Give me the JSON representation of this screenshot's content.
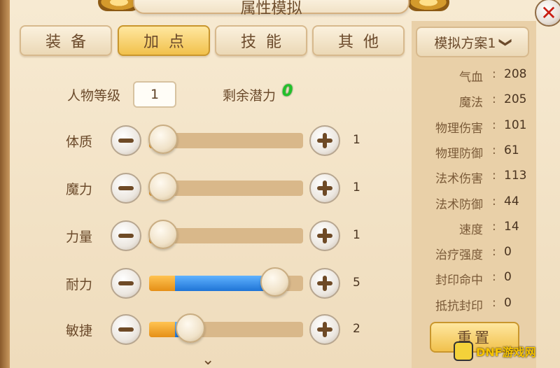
{
  "title": "属性模拟",
  "close_label": "✕",
  "tabs": [
    {
      "label": "装备",
      "active": false
    },
    {
      "label": "加点",
      "active": true
    },
    {
      "label": "技能",
      "active": false
    },
    {
      "label": "其他",
      "active": false
    }
  ],
  "level": {
    "label": "人物等级",
    "value": "1"
  },
  "potential": {
    "label": "剩余潜力",
    "value": "0"
  },
  "stats": [
    {
      "label": "体质",
      "value": "1",
      "base_fill": 0.09,
      "added_fill": 0.0,
      "knob": 0.09
    },
    {
      "label": "魔力",
      "value": "1",
      "base_fill": 0.09,
      "added_fill": 0.0,
      "knob": 0.09
    },
    {
      "label": "力量",
      "value": "1",
      "base_fill": 0.09,
      "added_fill": 0.0,
      "knob": 0.09
    },
    {
      "label": "耐力",
      "value": "5",
      "base_fill": 0.17,
      "added_fill": 0.65,
      "knob": 0.82
    },
    {
      "label": "敏捷",
      "value": "2",
      "base_fill": 0.17,
      "added_fill": 0.1,
      "knob": 0.27
    }
  ],
  "scheme": {
    "label": "模拟方案1",
    "chevron": "❯"
  },
  "attributes": [
    {
      "name": "气血",
      "value": "208"
    },
    {
      "name": "魔法",
      "value": "205"
    },
    {
      "name": "物理伤害",
      "value": "101"
    },
    {
      "name": "物理防御",
      "value": "61"
    },
    {
      "name": "法术伤害",
      "value": "113"
    },
    {
      "name": "法术防御",
      "value": "44"
    },
    {
      "name": "速度",
      "value": "14"
    },
    {
      "name": "治疗强度",
      "value": "0"
    },
    {
      "name": "封印命中",
      "value": "0"
    },
    {
      "name": "抵抗封印",
      "value": "0"
    }
  ],
  "colon": ":",
  "reset_label": "重置",
  "watermark": "DNF游戏网",
  "colors": {
    "accent": "#f1c14c",
    "base_fill": "#e58f16",
    "added_fill": "#1f74d6",
    "potential": "#21c22a",
    "close": "#c91e13"
  }
}
